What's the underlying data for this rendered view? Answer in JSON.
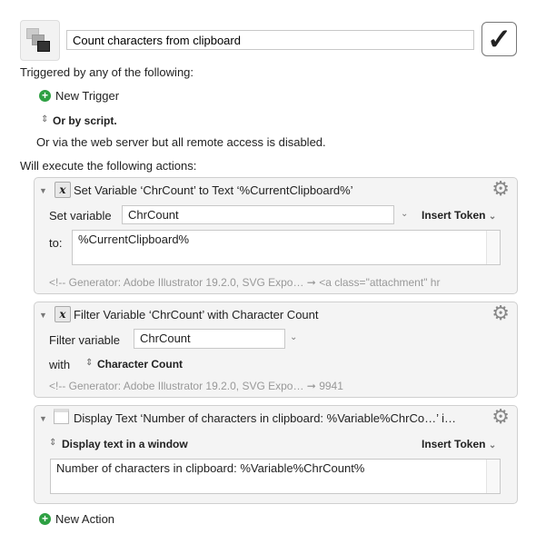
{
  "macro": {
    "name": "Count characters from clipboard",
    "enabled": true,
    "icon": "macro-windows-icon"
  },
  "triggers": {
    "heading": "Triggered by any of the following:",
    "new_trigger": "New Trigger",
    "or_by_script": "Or by script.",
    "web_server": "Or via the web server but all remote access is disabled."
  },
  "actions_heading": "Will execute the following actions:",
  "actions": [
    {
      "title": "Set Variable ‘ChrCount’ to Text ‘%CurrentClipboard%’",
      "var_label": "Set variable",
      "var_value": "ChrCount",
      "insert_token": "Insert Token",
      "to_label": "to:",
      "text": "%CurrentClipboard%",
      "result": "<!-- Generator: Adobe Illustrator 19.2.0, SVG Expo… ➞ <a class=\"attachment\" hr"
    },
    {
      "title": "Filter Variable ‘ChrCount’ with Character Count",
      "var_label": "Filter variable",
      "var_value": "ChrCount",
      "with_label": "with",
      "filter": "Character Count",
      "result": "<!-- Generator: Adobe Illustrator 19.2.0, SVG Expo… ➞ 9941"
    },
    {
      "title": "Display Text ‘Number of characters in clipboard: %Variable%ChrCo…’ i…",
      "mode": "Display text in a window",
      "insert_token": "Insert Token",
      "text": "Number of characters in clipboard: %Variable%ChrCount%"
    }
  ],
  "new_action": "New Action",
  "colors": {
    "accent_green": "#2ea043"
  }
}
